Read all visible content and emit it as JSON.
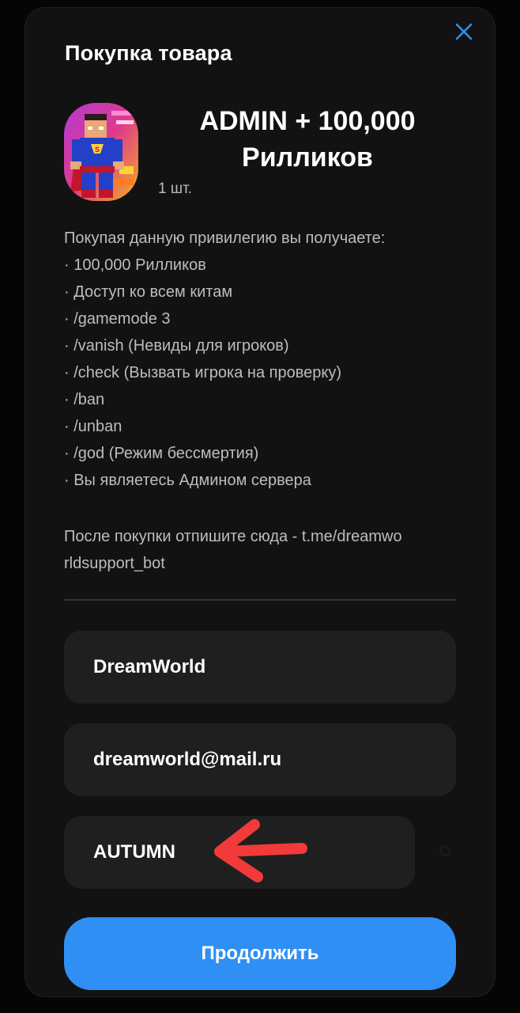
{
  "modal": {
    "title": "Покупка товара",
    "close_icon": "close-icon"
  },
  "product": {
    "image_icon": "superhero-avatar",
    "name": "ADMIN + 100,000 Рилликов",
    "quantity": "1 шт."
  },
  "description": {
    "intro": "Покупая данную привилегию вы получаете:",
    "items": [
      "· 100,000 Рилликов",
      "· Доступ ко всем китам",
      "· /gamemode 3",
      "· /vanish (Невиды для игроков)",
      "· /check (Вызвать игрока на проверку)",
      "· /ban",
      "· /unban",
      "· /god (Режим бессмертия)",
      "· Вы являетесь Админом сервера"
    ],
    "after_line1": "После покупки отпишите сюда - t.me/dreamwo",
    "after_line2": "rldsupport_bot"
  },
  "form": {
    "nickname_value": "DreamWorld",
    "email_value": "dreamworld@mail.ru",
    "promo_value": "AUTUMN"
  },
  "annotation": {
    "arrow_icon": "red-arrow-icon",
    "arrow_color": "#f23a3a"
  },
  "actions": {
    "continue_label": "Продолжить",
    "accent_color": "#2f8ff4"
  }
}
